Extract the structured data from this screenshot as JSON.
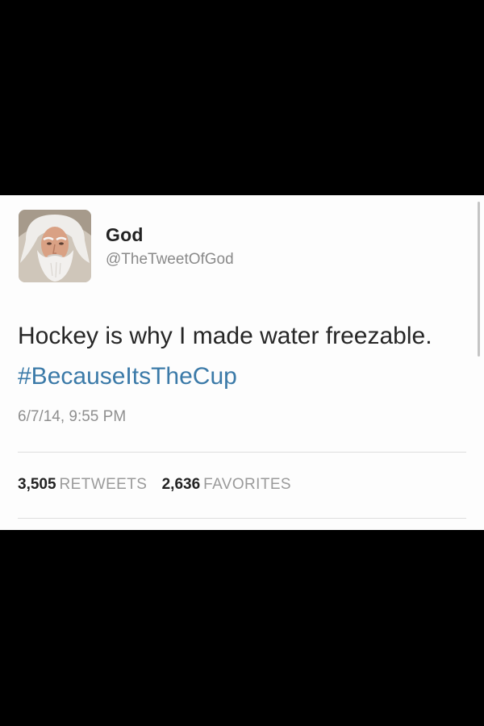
{
  "tweet": {
    "author": {
      "display_name": "God",
      "handle": "@TheTweetOfGod",
      "avatar_icon": "bearded-man-avatar"
    },
    "text": "Hockey is why I made water freezable.",
    "hashtag": "#BecauseItsTheCup",
    "timestamp": "6/7/14, 9:55 PM",
    "stats": {
      "retweets_count": "3,505",
      "retweets_label": "RETWEETS",
      "favorites_count": "2,636",
      "favorites_label": "FAVORITES"
    }
  },
  "colors": {
    "background": "#000000",
    "card": "#fdfdfd",
    "hashtag": "#3b7aa8",
    "muted_text": "#8f8f8f"
  }
}
